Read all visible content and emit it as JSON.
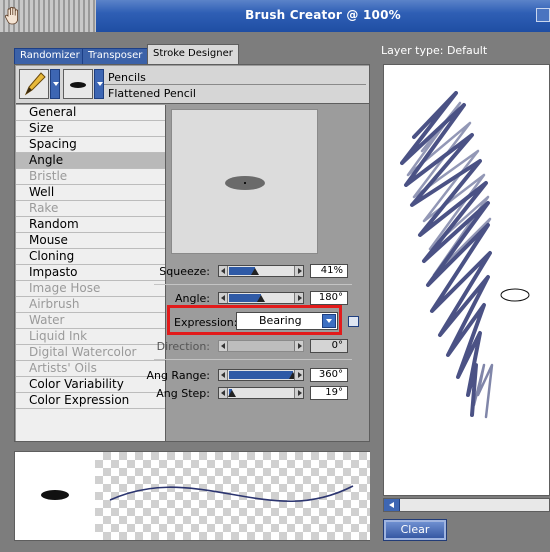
{
  "window": {
    "title": "Brush Creator @ 100%"
  },
  "tabs": [
    {
      "label": "Randomizer"
    },
    {
      "label": "Transposer"
    },
    {
      "label": "Stroke Designer"
    }
  ],
  "brush": {
    "category": "Pencils",
    "variant": "Flattened Pencil"
  },
  "categories": [
    {
      "label": "General",
      "enabled": true
    },
    {
      "label": "Size",
      "enabled": true
    },
    {
      "label": "Spacing",
      "enabled": true
    },
    {
      "label": "Angle",
      "enabled": true,
      "selected": true
    },
    {
      "label": "Bristle",
      "enabled": false
    },
    {
      "label": "Well",
      "enabled": true
    },
    {
      "label": "Rake",
      "enabled": false
    },
    {
      "label": "Random",
      "enabled": true
    },
    {
      "label": "Mouse",
      "enabled": true
    },
    {
      "label": "Cloning",
      "enabled": true
    },
    {
      "label": "Impasto",
      "enabled": true
    },
    {
      "label": "Image Hose",
      "enabled": false
    },
    {
      "label": "Airbrush",
      "enabled": false
    },
    {
      "label": "Water",
      "enabled": false
    },
    {
      "label": "Liquid Ink",
      "enabled": false
    },
    {
      "label": "Digital Watercolor",
      "enabled": false
    },
    {
      "label": "Artists' Oils",
      "enabled": false
    },
    {
      "label": "Color Variability",
      "enabled": true
    },
    {
      "label": "Color Expression",
      "enabled": true
    }
  ],
  "controls": {
    "squeeze": {
      "label": "Squeeze:",
      "value": "41%",
      "fraction": 0.41
    },
    "angle": {
      "label": "Angle:",
      "value": "180°",
      "fraction": 0.5
    },
    "expression": {
      "label": "Expression:",
      "selected": "Bearing"
    },
    "direction": {
      "label": "Direction:",
      "value": "0°",
      "fraction": 0.0
    },
    "ang_range": {
      "label": "Ang Range:",
      "value": "360°",
      "fraction": 1.0
    },
    "ang_step": {
      "label": "Ang Step:",
      "value": "19°",
      "fraction": 0.05
    }
  },
  "canvas": {
    "layer_type": "Layer type: Default"
  },
  "buttons": {
    "clear": "Clear"
  },
  "icons": {
    "app": "hand-icon",
    "brush_category": "pencil-icon",
    "brush_variant": "dab-icon"
  },
  "colors": {
    "accent": "#2f5aa6",
    "stroke": "#2c3570",
    "highlight": "#e21b1b"
  }
}
